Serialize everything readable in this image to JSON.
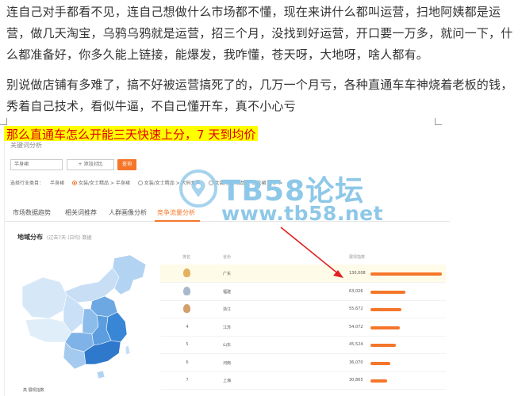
{
  "article": {
    "paragraph1": "连自己对手都看不见，连自己想做什么市场都不懂，现在来讲什么都叫运营，扫地阿姨都是运营，做几天淘宝，乌鸦乌鸦就是运营，招三个月，没找到好运营，开口要一万多，就问一下，什么都准备好，你多久能上链接，能爆发，我咋懂，苍天呀，大地呀，啥人都有。",
    "paragraph2": "别说做店铺有多难了，搞不好被运营搞死了的，几万一个月亏，各种直通车车神烧着老板的钱，秀着自己技术，看似牛逼，不自己懂开车，真不小心亏",
    "heading": "那么直通车怎么开能三天快速上分，7 天到均价"
  },
  "embedded_screenshot": {
    "section_title": "关键词分析",
    "keyword_input": "半身裙",
    "add_compare_label": "+ 添加对比",
    "query_button": "查询",
    "filter": {
      "label": "选择行业类目：",
      "keyword": "半身裙",
      "options": [
        "女装/女士精品 > 半身裙",
        "女装/女士精品 > 大码女装",
        "女装/女士精品 > 连衣裙 更多 >"
      ]
    },
    "tabs": [
      "市场数据趋势",
      "相关词推荐",
      "人群画像分析",
      "竞争流量分析"
    ],
    "map": {
      "title": "地域分布",
      "subtitle": "(过去7天 (日均) 数据",
      "legend": "高 展现指数"
    },
    "table": {
      "headers": {
        "rank": "排名",
        "province": "省份",
        "index": "展现指数"
      },
      "rows": [
        {
          "rank": "1",
          "province": "广东",
          "value": "130,008",
          "ratio": 1.0
        },
        {
          "rank": "2",
          "province": "福建",
          "value": "63,026",
          "ratio": 0.485
        },
        {
          "rank": "3",
          "province": "浙江",
          "value": "55,672",
          "ratio": 0.428
        },
        {
          "rank": "4",
          "province": "江苏",
          "value": "54,072",
          "ratio": 0.416
        },
        {
          "rank": "5",
          "province": "山东",
          "value": "45,524",
          "ratio": 0.35
        },
        {
          "rank": "6",
          "province": "河南",
          "value": "36,070",
          "ratio": 0.277
        },
        {
          "rank": "7",
          "province": "上海",
          "value": "30,865",
          "ratio": 0.237
        }
      ]
    }
  },
  "watermark": {
    "forum": "TB58论坛",
    "url": "www.tb58.net"
  },
  "colors": {
    "accent": "#f5762a",
    "heading_bg": "#ffff00",
    "heading_text": "#e00000",
    "watermark": "#8ec8e8",
    "arrow": "#e02020"
  }
}
